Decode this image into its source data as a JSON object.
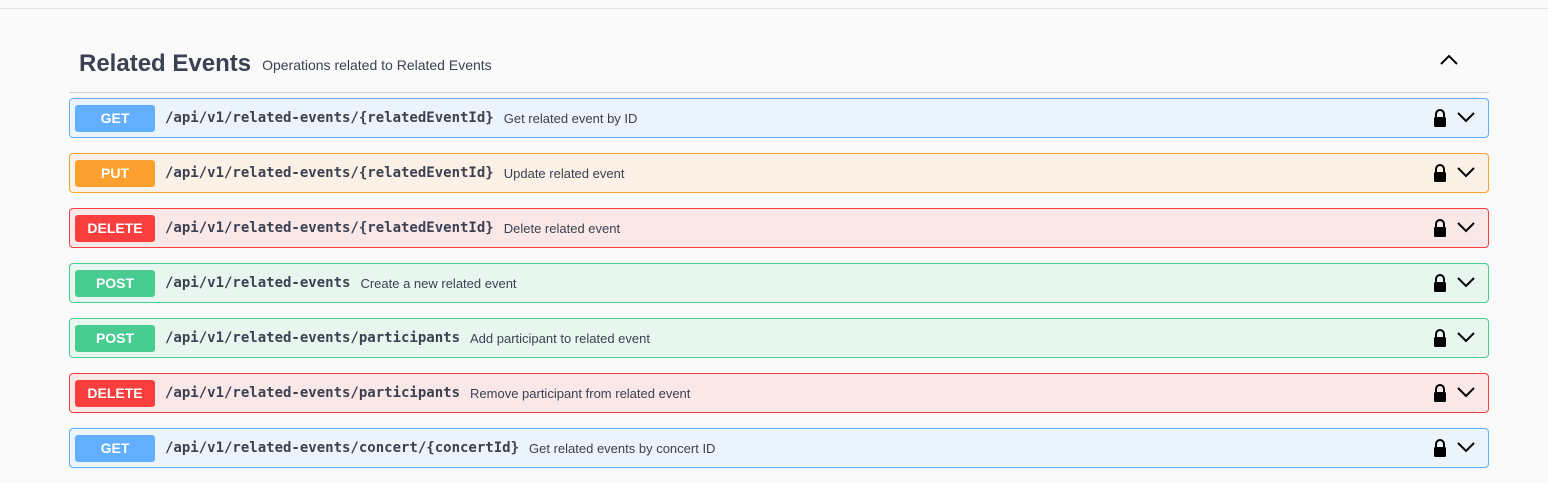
{
  "section": {
    "title": "Related Events",
    "description": "Operations related to Related Events"
  },
  "operations": [
    {
      "method": "GET",
      "path": "/api/v1/related-events/{relatedEventId}",
      "summary": "Get related event by ID"
    },
    {
      "method": "PUT",
      "path": "/api/v1/related-events/{relatedEventId}",
      "summary": "Update related event"
    },
    {
      "method": "DELETE",
      "path": "/api/v1/related-events/{relatedEventId}",
      "summary": "Delete related event"
    },
    {
      "method": "POST",
      "path": "/api/v1/related-events",
      "summary": "Create a new related event"
    },
    {
      "method": "POST",
      "path": "/api/v1/related-events/participants",
      "summary": "Add participant to related event"
    },
    {
      "method": "DELETE",
      "path": "/api/v1/related-events/participants",
      "summary": "Remove participant from related event"
    },
    {
      "method": "GET",
      "path": "/api/v1/related-events/concert/{concertId}",
      "summary": "Get related events by concert ID"
    }
  ],
  "colors": {
    "get": "#61affe",
    "put": "#fca130",
    "delete": "#f93e3e",
    "post": "#49cc90"
  },
  "icons": {
    "collapse": "chevron-up-icon",
    "lock": "lock-icon",
    "expand": "chevron-down-icon"
  }
}
